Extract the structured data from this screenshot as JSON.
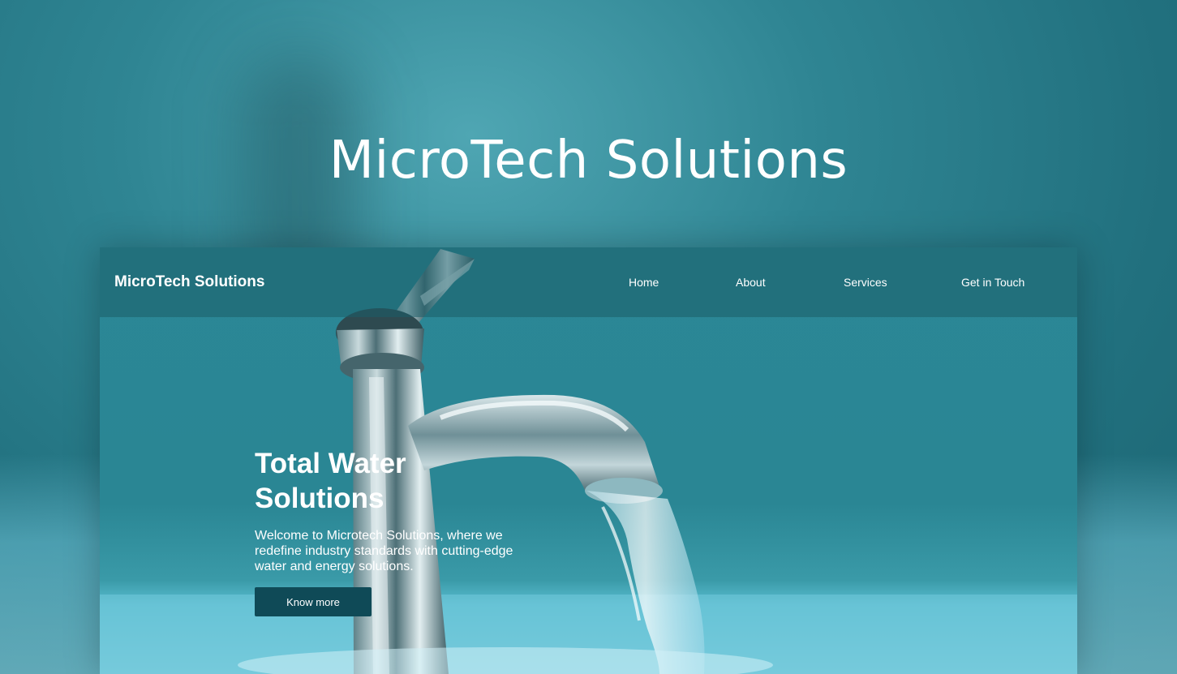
{
  "hero": {
    "title": "MicroTech Solutions"
  },
  "nav": {
    "brand": "MicroTech Solutions",
    "links": [
      "Home",
      "About",
      "Services",
      "Get in Touch"
    ]
  },
  "main": {
    "headline_line1": "Total Water",
    "headline_line2": "Solutions",
    "intro": "Welcome to Microtech Solutions, where we redefine industry standards with cutting-edge water and energy solutions.",
    "cta_label": "Know more"
  },
  "colors": {
    "background": "#2f8593",
    "navbar": "#1c5c68",
    "button": "#0f4a57",
    "text": "#ffffff"
  }
}
